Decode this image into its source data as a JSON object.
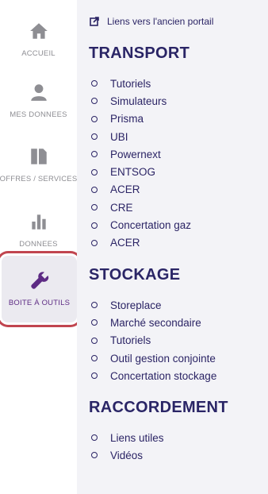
{
  "sidebar": {
    "items": [
      {
        "label": "ACCUEIL",
        "icon": "home-icon"
      },
      {
        "label": "MES DONNEES",
        "icon": "user-icon"
      },
      {
        "label": "OFFRES / SERVICES",
        "icon": "documents-icon"
      },
      {
        "label": "DONNEES",
        "icon": "bar-chart-icon"
      },
      {
        "label": "BOITE À OUTILS",
        "icon": "wrench-icon",
        "active": true
      }
    ]
  },
  "panel": {
    "old_portal_link": "Liens vers l'ancien portail",
    "sections": [
      {
        "title": "TRANSPORT",
        "links": [
          "Tutoriels",
          "Simulateurs",
          "Prisma",
          "UBI",
          "Powernext",
          "ENTSOG",
          "ACER",
          "CRE",
          "Concertation gaz",
          "ACER"
        ]
      },
      {
        "title": "STOCKAGE",
        "links": [
          "Storeplace",
          "Marché secondaire",
          "Tutoriels",
          "Outil gestion conjointe",
          "Concertation stockage"
        ]
      },
      {
        "title": "RACCORDEMENT",
        "links": [
          "Liens utiles",
          "Vidéos"
        ]
      }
    ]
  },
  "colors": {
    "accent": "#5d2b84",
    "text": "#2b2465",
    "highlight_border": "#c1454f",
    "panel_bg": "#f3f3f7",
    "nav_grey": "#8e8e93"
  }
}
